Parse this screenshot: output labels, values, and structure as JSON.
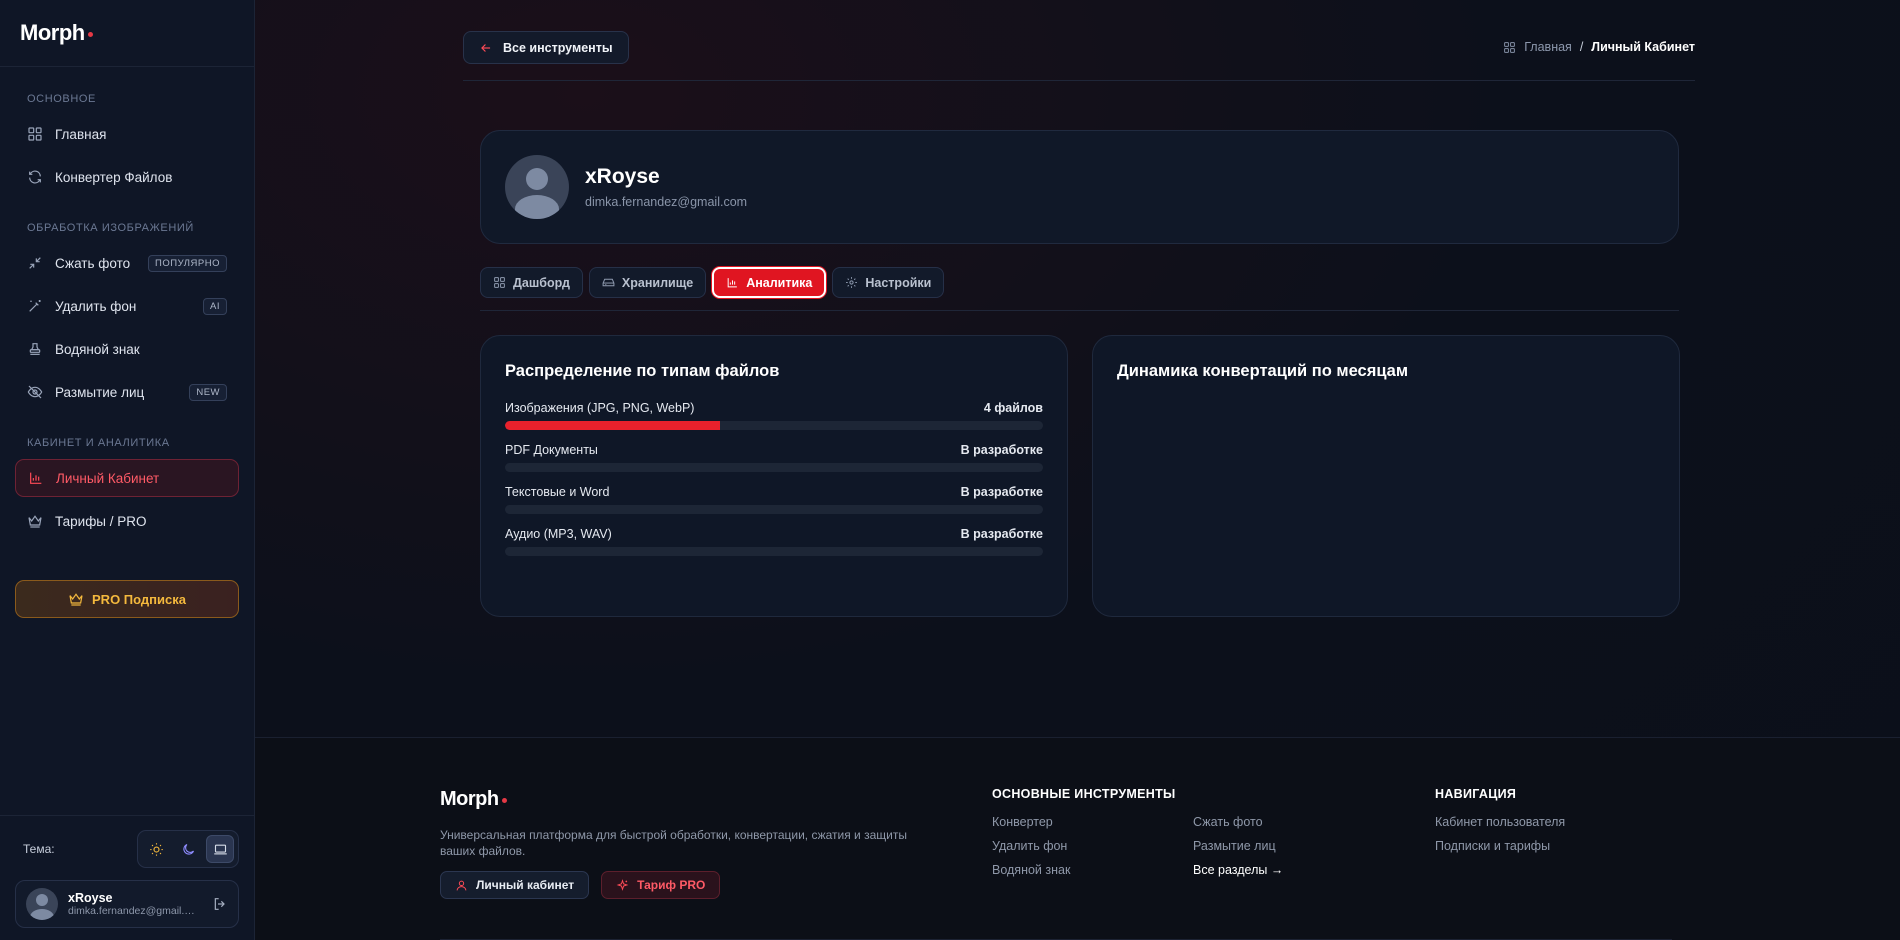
{
  "brand": {
    "name": "Morph"
  },
  "sidebar": {
    "sections": [
      {
        "title": "Основное"
      },
      {
        "title": "Обработка изображений"
      },
      {
        "title": "Кабинет и аналитика"
      }
    ],
    "items": [
      {
        "label": "Главная",
        "icon": "grid-icon"
      },
      {
        "label": "Конвертер Файлов",
        "icon": "refresh-icon"
      },
      {
        "label": "Сжать фото",
        "badge": "ПОПУЛЯРНО",
        "icon": "compress-icon"
      },
      {
        "label": "Удалить фон",
        "badge": "AI",
        "icon": "magic-wand-icon"
      },
      {
        "label": "Водяной знак",
        "icon": "stamp-icon"
      },
      {
        "label": "Размытие лиц",
        "badge": "NEW",
        "icon": "eye-off-icon"
      },
      {
        "label": "Личный Кабинет",
        "icon": "bar-chart-icon",
        "active": true
      },
      {
        "label": "Тарифы / PRO",
        "icon": "crown-icon"
      }
    ],
    "pro_button": "PRO Подписка",
    "theme_label": "Тема:",
    "user": {
      "name": "xRoyse",
      "email": "dimka.fernandez@gmail.com"
    }
  },
  "topbar": {
    "back_label": "Все инструменты",
    "breadcrumb": {
      "home": "Главная",
      "separator": "/",
      "current": "Личный Кабинет"
    }
  },
  "profile": {
    "name": "xRoyse",
    "email": "dimka.fernandez@gmail.com"
  },
  "tabs": [
    {
      "label": "Дашборд",
      "icon": "grid-icon"
    },
    {
      "label": "Хранилище",
      "icon": "drive-icon"
    },
    {
      "label": "Аналитика",
      "icon": "bar-chart-icon",
      "active": true
    },
    {
      "label": "Настройки",
      "icon": "gear-icon"
    }
  ],
  "distribution": {
    "title": "Распределение по типам файлов",
    "rows": [
      {
        "label": "Изображения (JPG, PNG, WebP)",
        "value": "4 файлов",
        "fill_percent": 40
      },
      {
        "label": "PDF Документы",
        "value": "В разработке",
        "fill_percent": 0
      },
      {
        "label": "Текстовые и Word",
        "value": "В разработке",
        "fill_percent": 0
      },
      {
        "label": "Аудио (MP3, WAV)",
        "value": "В разработке",
        "fill_percent": 0
      }
    ]
  },
  "monthly": {
    "title": "Динамика конвертаций по месяцам"
  },
  "footer": {
    "brand": "Morph",
    "description": "Универсальная платформа для быстрой обработки, конвертации, сжатия и защиты ваших файлов.",
    "account_button": "Личный кабинет",
    "pro_button": "Тариф PRO",
    "tools_title": "ОСНОВНЫЕ ИНСТРУМЕНТЫ",
    "tools": [
      "Конвертер",
      "Сжать фото",
      "Удалить фон",
      "Размытие лиц",
      "Водяной знак",
      "Все разделы →"
    ],
    "nav_title": "НАВИГАЦИЯ",
    "nav": [
      "Кабинет пользователя",
      "Подписки и тарифы"
    ]
  },
  "colors": {
    "accent": "#e01521",
    "gold": "#f4b93d",
    "background": "#0b0f1a"
  }
}
